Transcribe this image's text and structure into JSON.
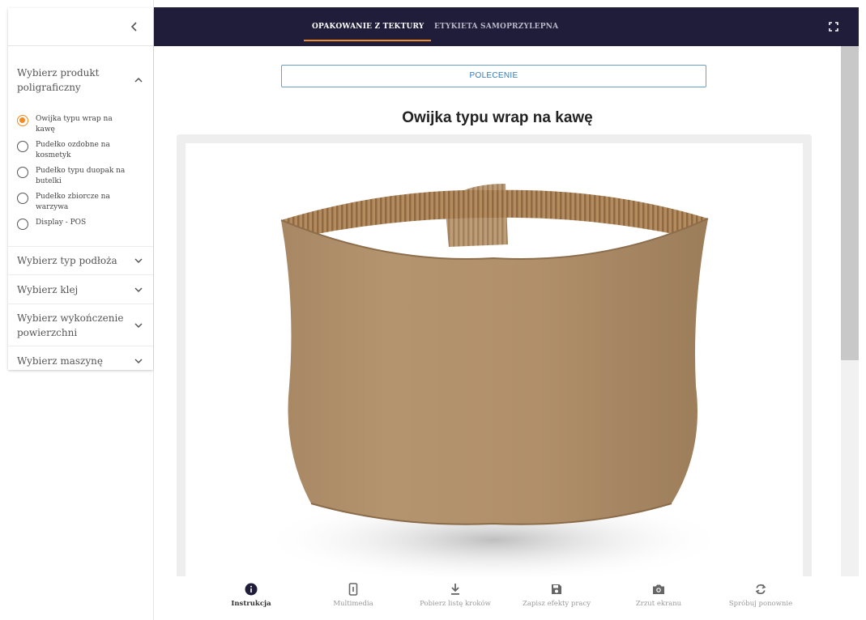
{
  "sidebar": {
    "sections": [
      {
        "label": "Wybierz produkt poligraficzny",
        "expanded": true,
        "options": [
          {
            "label": "Owijka typu wrap na kawę",
            "selected": true
          },
          {
            "label": "Pudełko ozdobne na kosmetyk",
            "selected": false
          },
          {
            "label": "Pudełko typu duopak na butelki",
            "selected": false
          },
          {
            "label": "Pudełko zbiorcze na warzywa",
            "selected": false
          },
          {
            "label": "Display - POS",
            "selected": false
          }
        ]
      },
      {
        "label": "Wybierz typ podłoża",
        "expanded": false
      },
      {
        "label": "Wybierz klej",
        "expanded": false
      },
      {
        "label": "Wybierz wykończenie powierzchni",
        "expanded": false
      },
      {
        "label": "Wybierz maszynę",
        "expanded": false
      }
    ]
  },
  "topbar": {
    "tabs": [
      {
        "label": "OPAKOWANIE Z TEKTURY",
        "active": true
      },
      {
        "label": "ETYKIETA SAMOPRZYLEPNA",
        "active": false
      }
    ],
    "accent_color": "#f08a24",
    "background": "#1f1d3a"
  },
  "main": {
    "command_button": "POLECENIE",
    "product_title": "Owijka typu wrap na kawę"
  },
  "toolbar": {
    "items": [
      {
        "label": "Instrukcja",
        "icon": "info-icon",
        "active": true
      },
      {
        "label": "Multimedia",
        "icon": "phone-icon",
        "active": false
      },
      {
        "label": "Pobierz listę kroków",
        "icon": "download-icon",
        "active": false
      },
      {
        "label": "Zapisz efekty pracy",
        "icon": "save-icon",
        "active": false
      },
      {
        "label": "Zrzut ekranu",
        "icon": "camera-icon",
        "active": false
      },
      {
        "label": "Spróbuj ponownie",
        "icon": "refresh-icon",
        "active": false
      }
    ]
  }
}
